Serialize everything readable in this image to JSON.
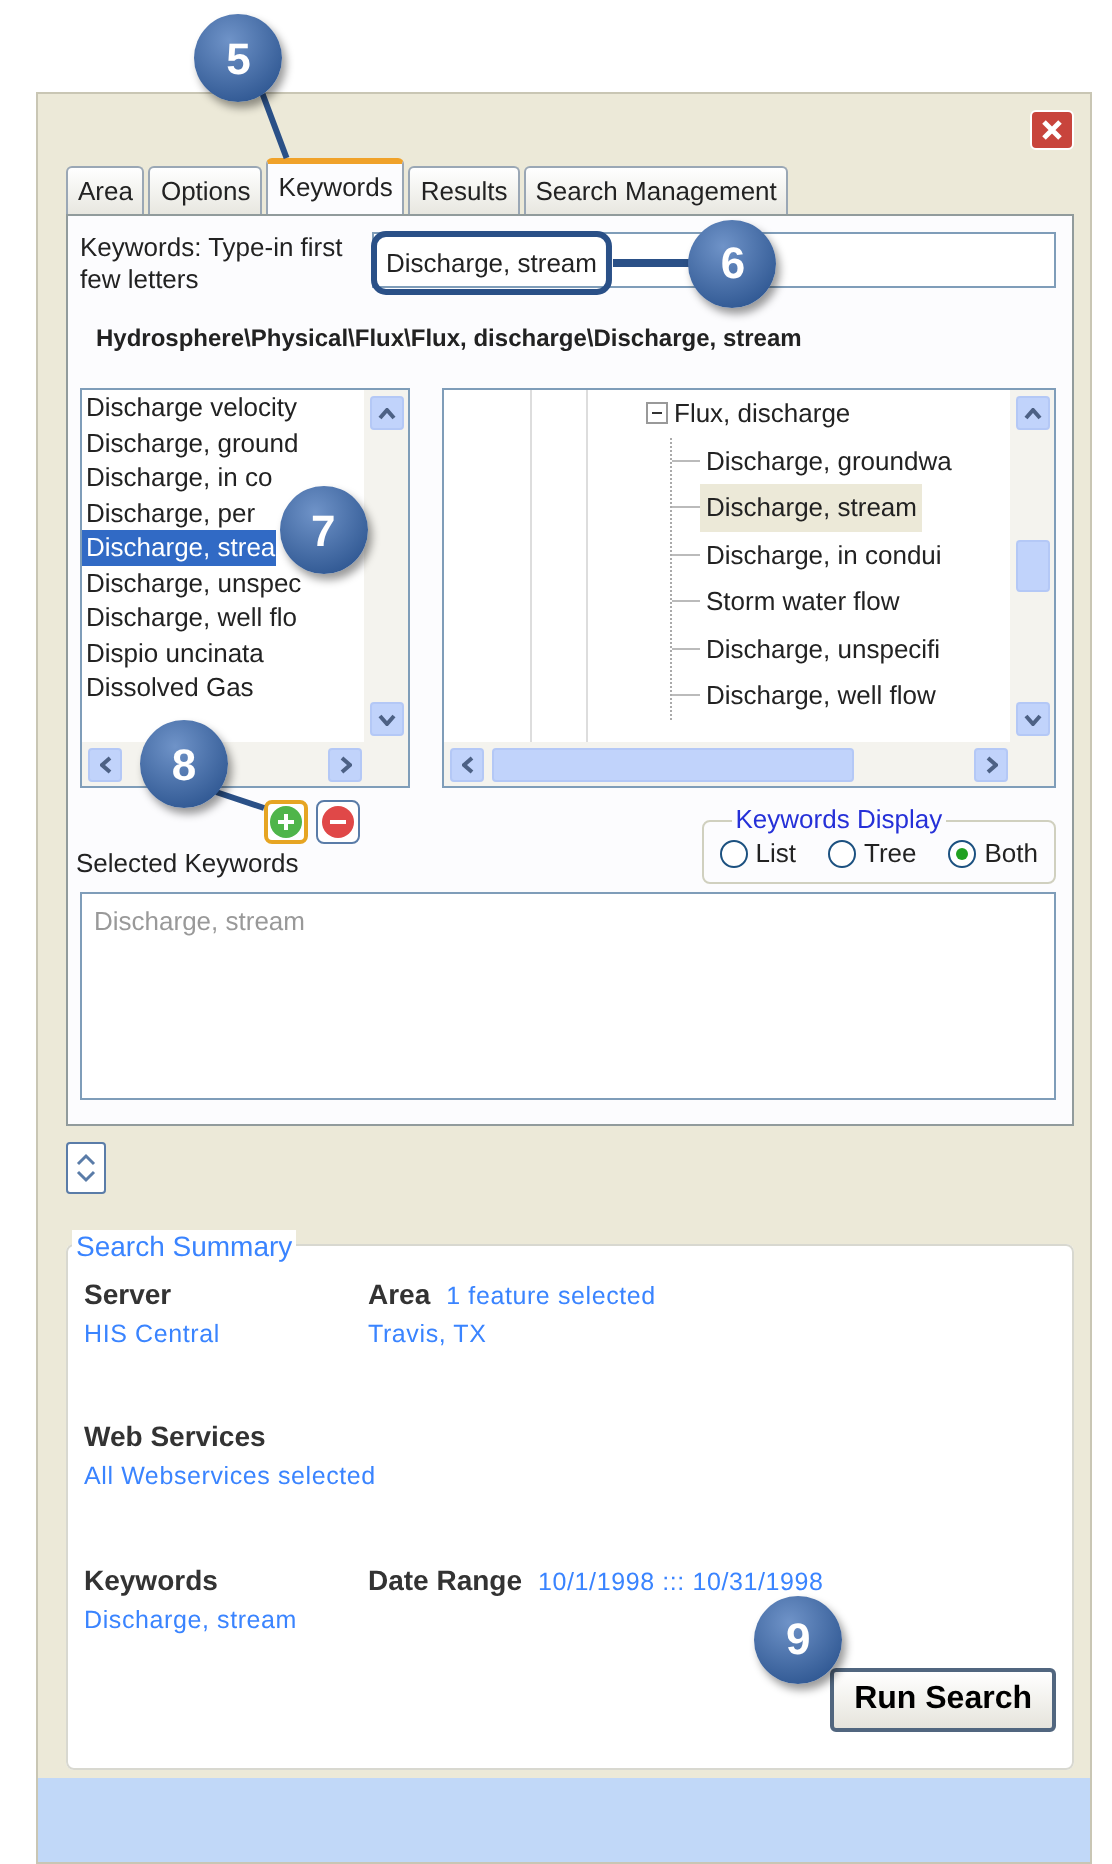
{
  "callouts": [
    "5",
    "6",
    "7",
    "8",
    "9"
  ],
  "tabs": [
    {
      "label": "Area",
      "selected": false
    },
    {
      "label": "Options",
      "selected": false
    },
    {
      "label": "Keywords",
      "selected": true
    },
    {
      "label": "Results",
      "selected": false
    },
    {
      "label": "Search Management",
      "selected": false
    }
  ],
  "keyword_search": {
    "label": "Keywords: Type-in first few letters",
    "value": "Discharge, stream",
    "path": "Hydrosphere\\Physical\\Flux\\Flux, discharge\\Discharge, stream"
  },
  "keyword_list": [
    {
      "label": "Discharge velocity",
      "selected": false
    },
    {
      "label": "Discharge, ground",
      "selected": false
    },
    {
      "label": "Discharge, in co",
      "selected": false
    },
    {
      "label": "Discharge, per",
      "selected": false
    },
    {
      "label": "Discharge, strea",
      "selected": true
    },
    {
      "label": "Discharge, unspec",
      "selected": false
    },
    {
      "label": "Discharge, well flo",
      "selected": false
    },
    {
      "label": "Dispio uncinata",
      "selected": false
    },
    {
      "label": "Dissolved Gas",
      "selected": false
    }
  ],
  "keyword_tree": [
    {
      "label": "Flux, discharge",
      "expanded": true,
      "children": [
        {
          "label": "Discharge, groundwa",
          "selected": false
        },
        {
          "label": "Discharge, stream",
          "selected": true
        },
        {
          "label": "Discharge, in condui",
          "selected": false
        },
        {
          "label": "Storm water flow",
          "selected": false
        },
        {
          "label": "Discharge, unspecifi",
          "selected": false
        },
        {
          "label": "Discharge, well flow",
          "selected": false
        }
      ]
    }
  ],
  "keywords_display": {
    "title": "Keywords Display",
    "options": [
      {
        "label": "List",
        "selected": false
      },
      {
        "label": "Tree",
        "selected": false
      },
      {
        "label": "Both",
        "selected": true
      }
    ]
  },
  "selected_keywords": {
    "label": "Selected Keywords",
    "items": [
      "Discharge, stream"
    ]
  },
  "search_summary": {
    "title": "Search Summary",
    "rows": [
      [
        {
          "label": "Server",
          "value": "HIS Central"
        },
        {
          "label": "Area",
          "note": "1 feature selected",
          "value": "Travis, TX"
        }
      ],
      [
        {
          "label": "Web Services",
          "value": "All Webservices selected"
        }
      ],
      [
        {
          "label": "Keywords",
          "value": "Discharge, stream"
        },
        {
          "label": "Date Range",
          "note": "10/1/1998 ::: 10/31/1998"
        }
      ]
    ]
  },
  "run_button": "Run Search"
}
